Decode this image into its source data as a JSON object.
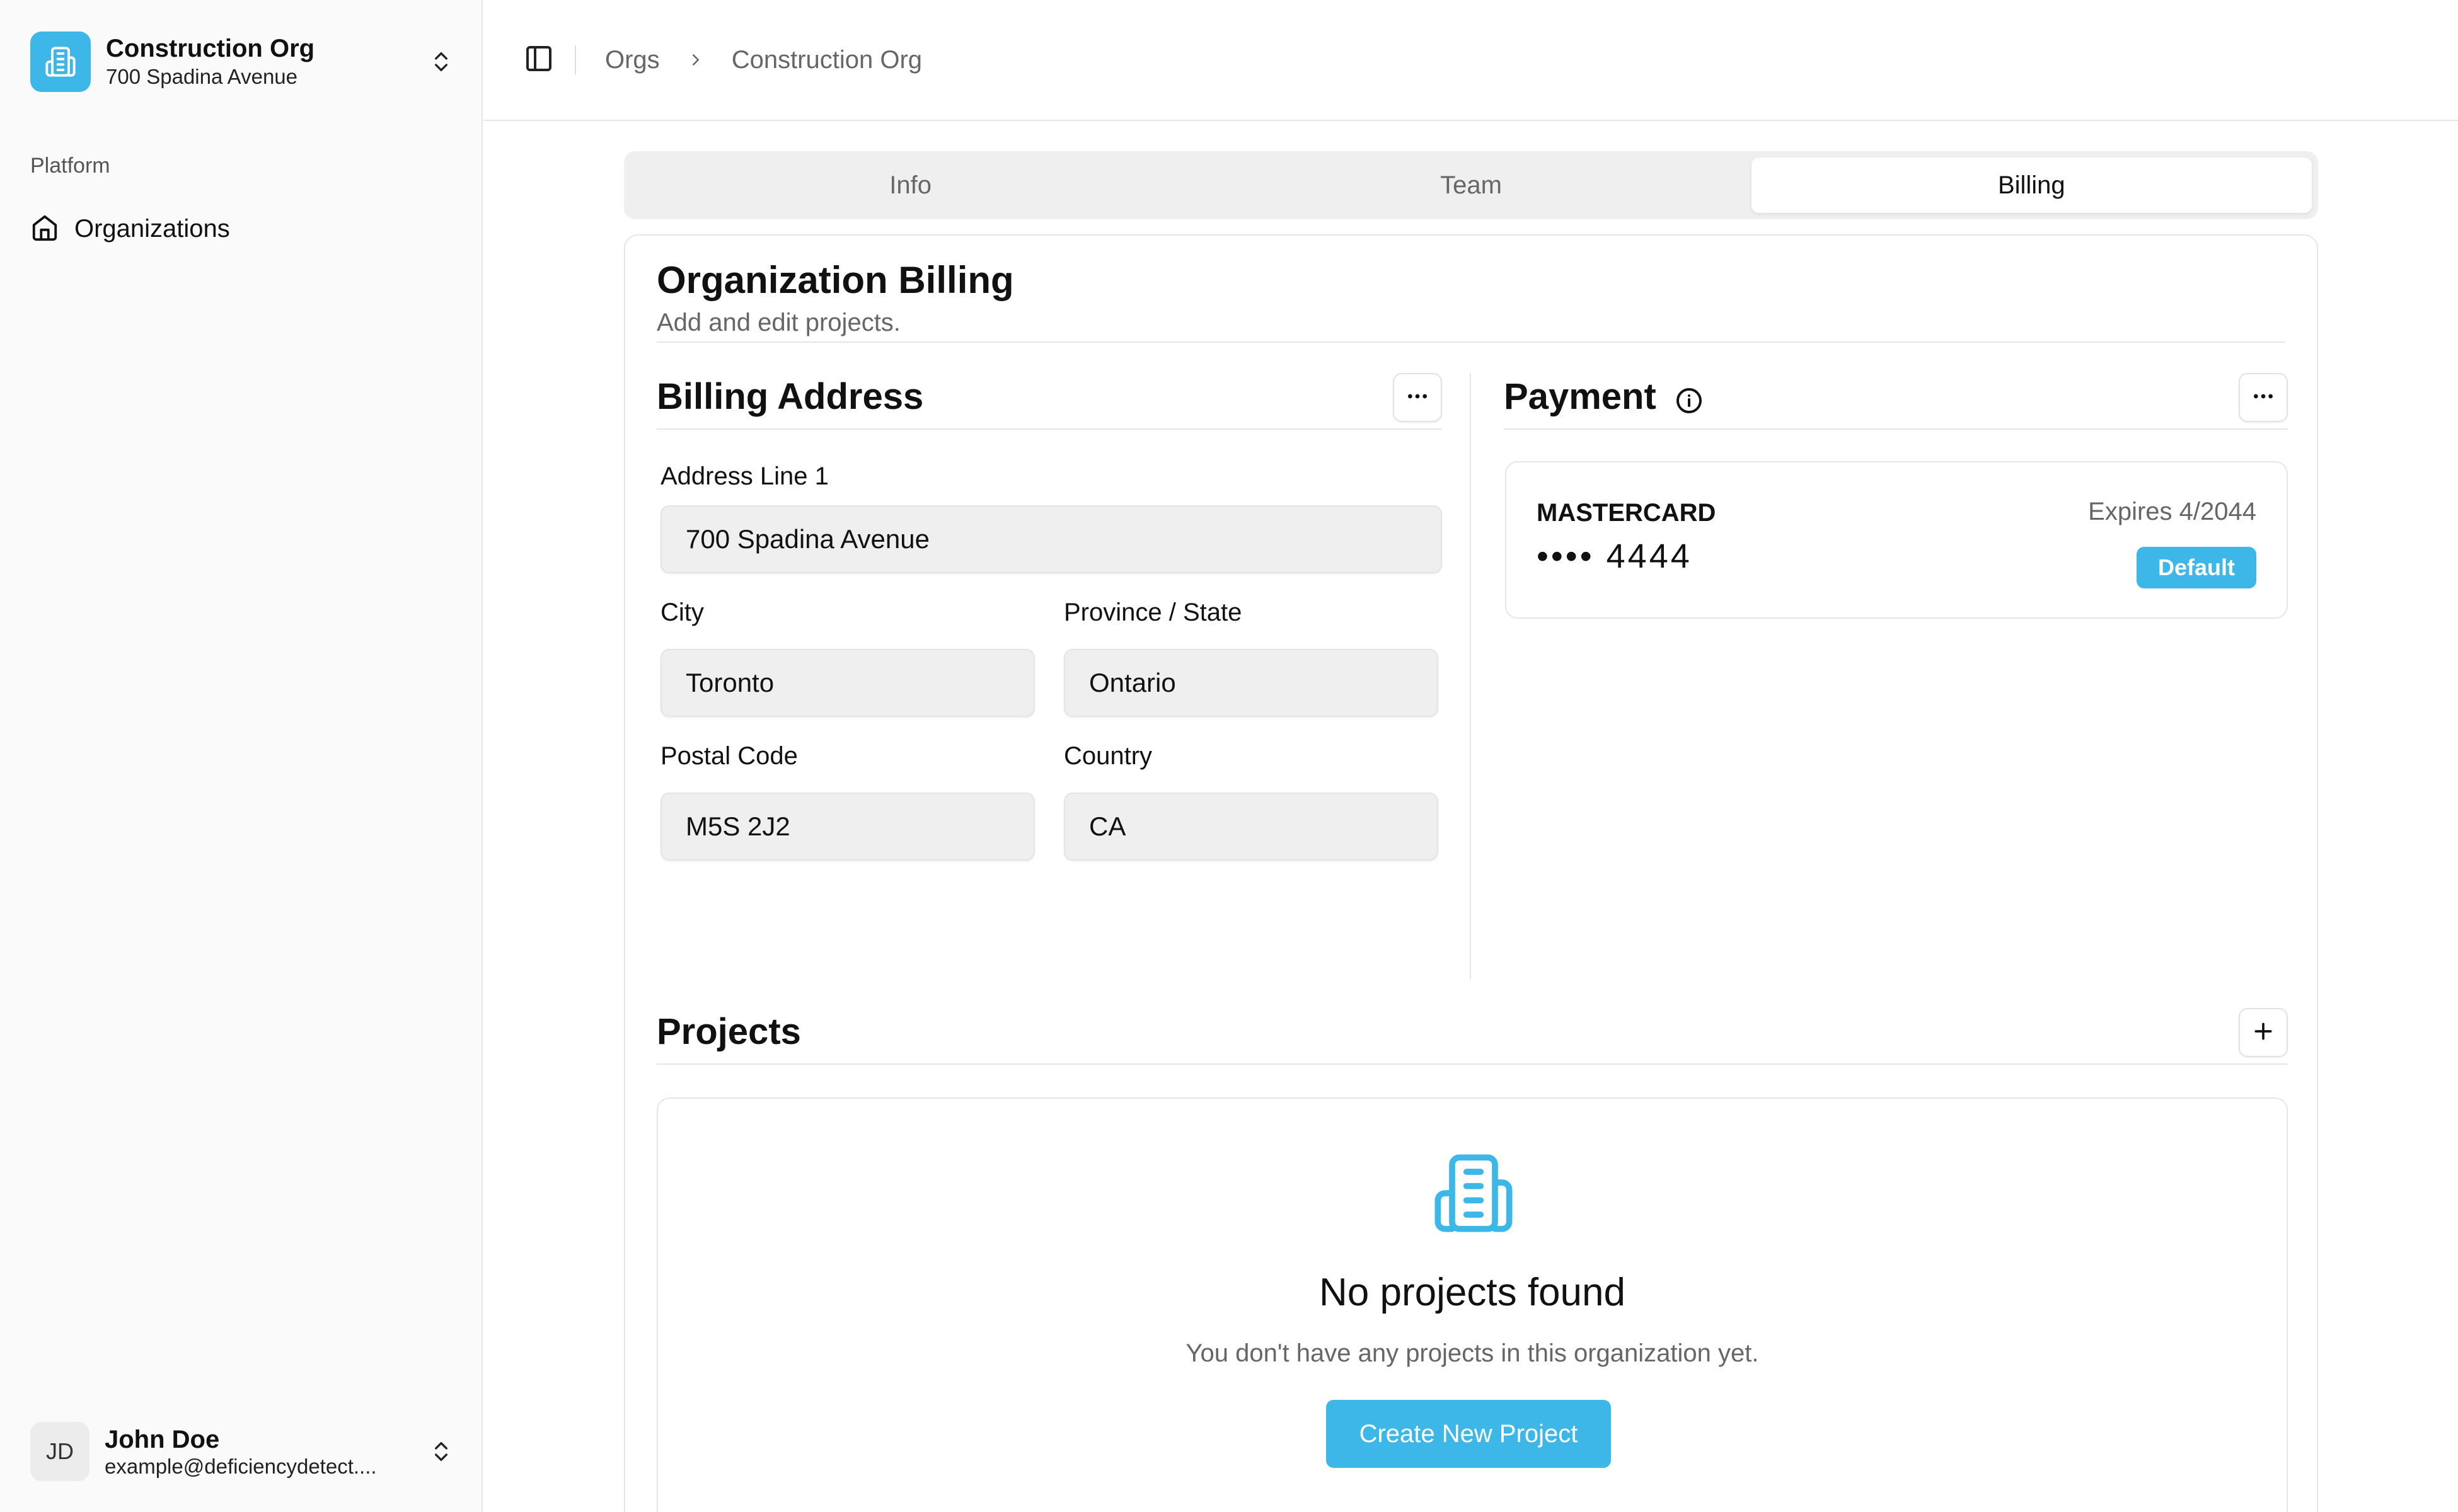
{
  "org_switcher": {
    "name": "Construction Org",
    "address": "700 Spadina Avenue",
    "logo_icon": "building-icon",
    "accent": "#3cb7e8"
  },
  "sidebar": {
    "group_label": "Platform",
    "items": [
      {
        "label": "Organizations",
        "icon": "home-icon"
      }
    ]
  },
  "user": {
    "initials": "JD",
    "name": "John Doe",
    "email": "example@deficiencydetect...."
  },
  "header": {
    "breadcrumb": [
      "Orgs",
      "Construction Org"
    ]
  },
  "tabs": [
    {
      "label": "Info",
      "active": false
    },
    {
      "label": "Team",
      "active": false
    },
    {
      "label": "Billing",
      "active": true
    }
  ],
  "billing": {
    "title": "Organization Billing",
    "subtitle": "Add and edit projects.",
    "address_section": {
      "title": "Billing Address",
      "fields": {
        "address_line_1": {
          "label": "Address Line 1",
          "value": "700 Spadina Avenue"
        },
        "city": {
          "label": "City",
          "value": "Toronto"
        },
        "province": {
          "label": "Province / State",
          "value": "Ontario"
        },
        "postal_code": {
          "label": "Postal Code",
          "value": "M5S 2J2"
        },
        "country": {
          "label": "Country",
          "value": "CA"
        }
      }
    },
    "payment_section": {
      "title": "Payment",
      "card": {
        "brand": "MASTERCARD",
        "number": "•••• 4444",
        "expires": "Expires 4/2044",
        "badge": "Default"
      }
    },
    "projects_section": {
      "title": "Projects",
      "empty_title": "No projects found",
      "empty_desc": "You don't have any projects in this organization yet.",
      "create_label": "Create New Project"
    }
  }
}
